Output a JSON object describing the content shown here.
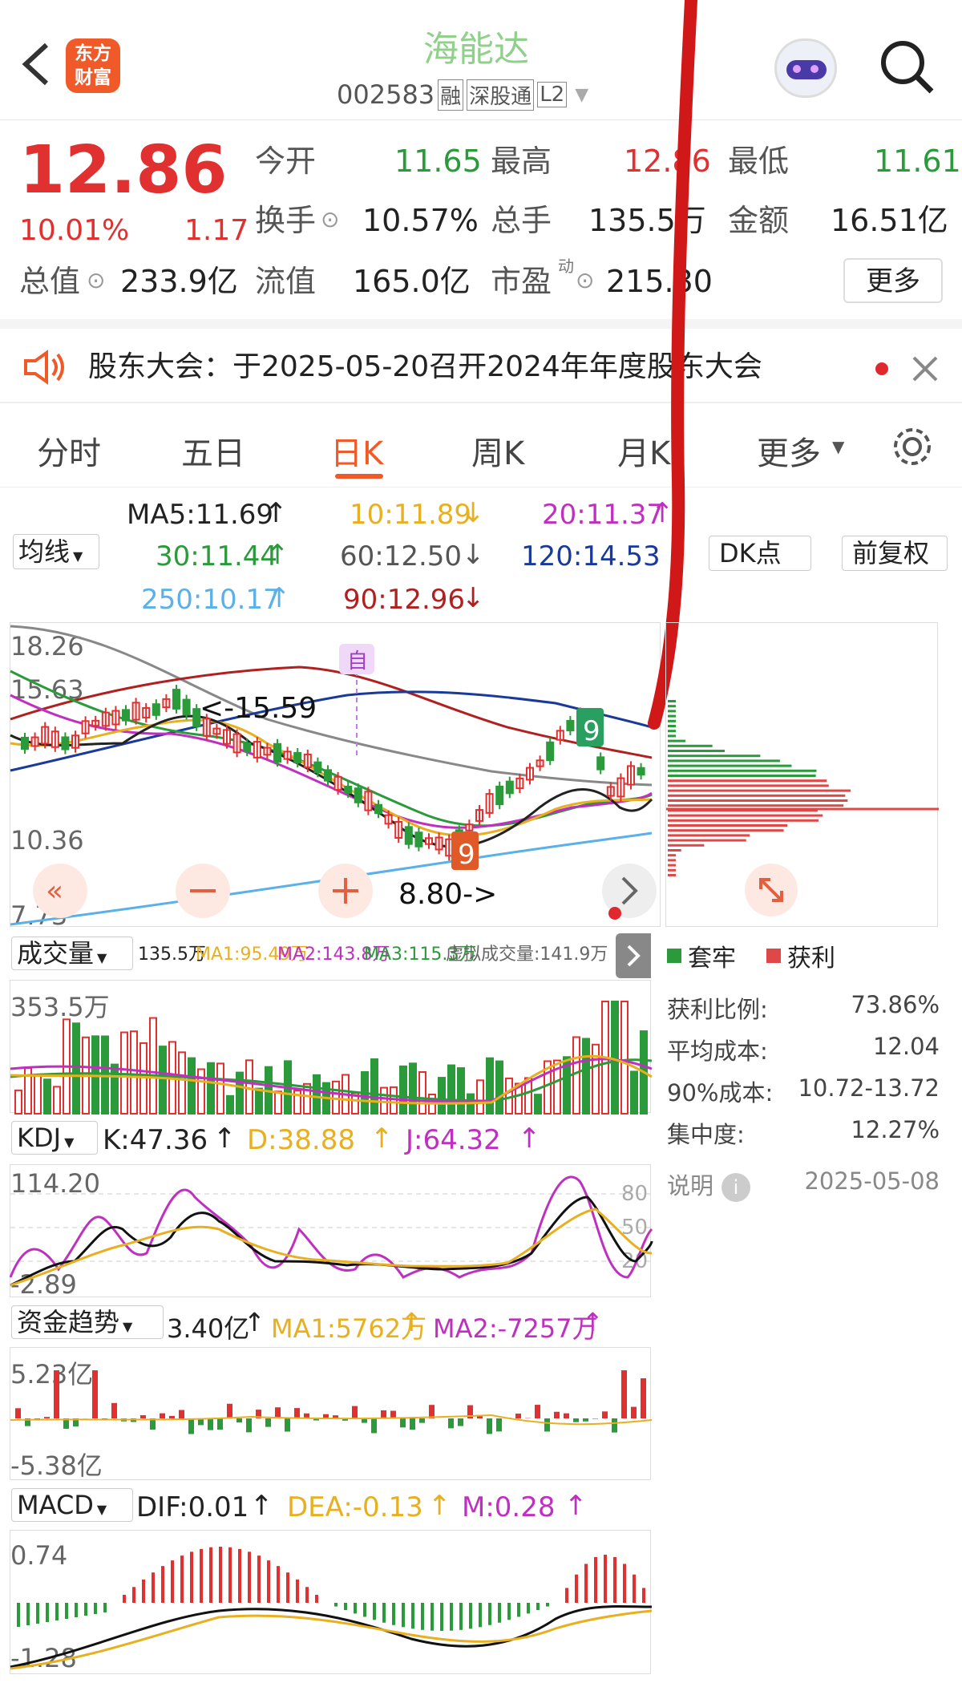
{
  "header": {
    "logo_line1": "东方",
    "logo_line2": "财富",
    "stock_name": "海能达",
    "code": "002583",
    "tags": [
      "融",
      "深股通",
      "L2"
    ]
  },
  "quote": {
    "price": "12.86",
    "pct": "10.01%",
    "change": "1.17",
    "open_label": "今开",
    "open": "11.65",
    "high_label": "最高",
    "high": "12.86",
    "low_label": "最低",
    "low": "11.61",
    "turnover_label": "换手",
    "turnover": "10.57%",
    "volume_label": "总手",
    "volume": "135.5万",
    "amount_label": "金额",
    "amount": "16.51亿",
    "mcap_label": "总值",
    "mcap": "233.9亿",
    "float_label": "流值",
    "float": "165.0亿",
    "pe_label": "市盈",
    "pe_sup": "动",
    "pe": "215.30",
    "more": "更多"
  },
  "notice": {
    "text": "股东大会：于2025-05-20召开2024年年度股东大会"
  },
  "tabs": [
    "分时",
    "五日",
    "日K",
    "周K",
    "月K",
    "更多"
  ],
  "active_tab": "日K",
  "ma": {
    "selector": "均线",
    "ma5": "MA5:11.69",
    "ma10": "10:11.89",
    "ma20": "20:11.37",
    "ma30": "30:11.44",
    "ma60": "60:12.50",
    "ma120": "120:14.53",
    "ma250": "250:10.17",
    "ma90": "90:12.96",
    "dk": "DK点",
    "fq": "前复权"
  },
  "kline": {
    "y_ticks": [
      "18.26",
      "15.63",
      "10.36",
      "7.73"
    ],
    "high_note": "<-15.59",
    "low_note": "8.80->",
    "self_mark": "自",
    "seq_a": "9",
    "seq_b": "9"
  },
  "volume": {
    "selector": "成交量",
    "vol": "135.5万",
    "ma1": "MA1:95.49万",
    "ma2": "MA2:143.8万",
    "ma3": "MA3:115.3万",
    "virtual": "虚拟成交量:141.9万",
    "top": "353.5万"
  },
  "kdj": {
    "selector": "KDJ",
    "k": "K:47.36",
    "d": "D:38.88",
    "j": "J:64.32",
    "top": "114.20",
    "bottom": "-2.89",
    "levels": [
      "80",
      "50",
      "20"
    ]
  },
  "fund": {
    "selector": "资金趋势",
    "val": "3.40亿",
    "ma1": "MA1:5762万",
    "ma2": "MA2:-7257万",
    "top": "5.23亿",
    "bottom": "-5.38亿"
  },
  "macd": {
    "selector": "MACD",
    "dif": "DIF:0.01",
    "dea": "DEA:-0.13",
    "m": "M:0.28",
    "top": "0.74",
    "bottom": "-1.28"
  },
  "chips": {
    "legend_trapped": "套牢",
    "legend_profit": "获利",
    "rows": [
      {
        "label": "获利比例:",
        "value": "73.86%"
      },
      {
        "label": "平均成本:",
        "value": "12.04"
      },
      {
        "label": "90%成本:",
        "value": "10.72-13.72"
      },
      {
        "label": "集中度:",
        "value": "12.27%"
      }
    ],
    "note_label": "说明",
    "date": "2025-05-08"
  },
  "colors": {
    "up": "#e03030",
    "down": "#2a9a3a",
    "brand": "#f05a28",
    "ma10": "#e8b020",
    "ma20": "#c030c0",
    "ma30": "#2a9a3a",
    "ma60": "#888888",
    "ma120": "#1a3a9a",
    "ma250": "#5ab0e8",
    "ma90": "#b02020"
  }
}
